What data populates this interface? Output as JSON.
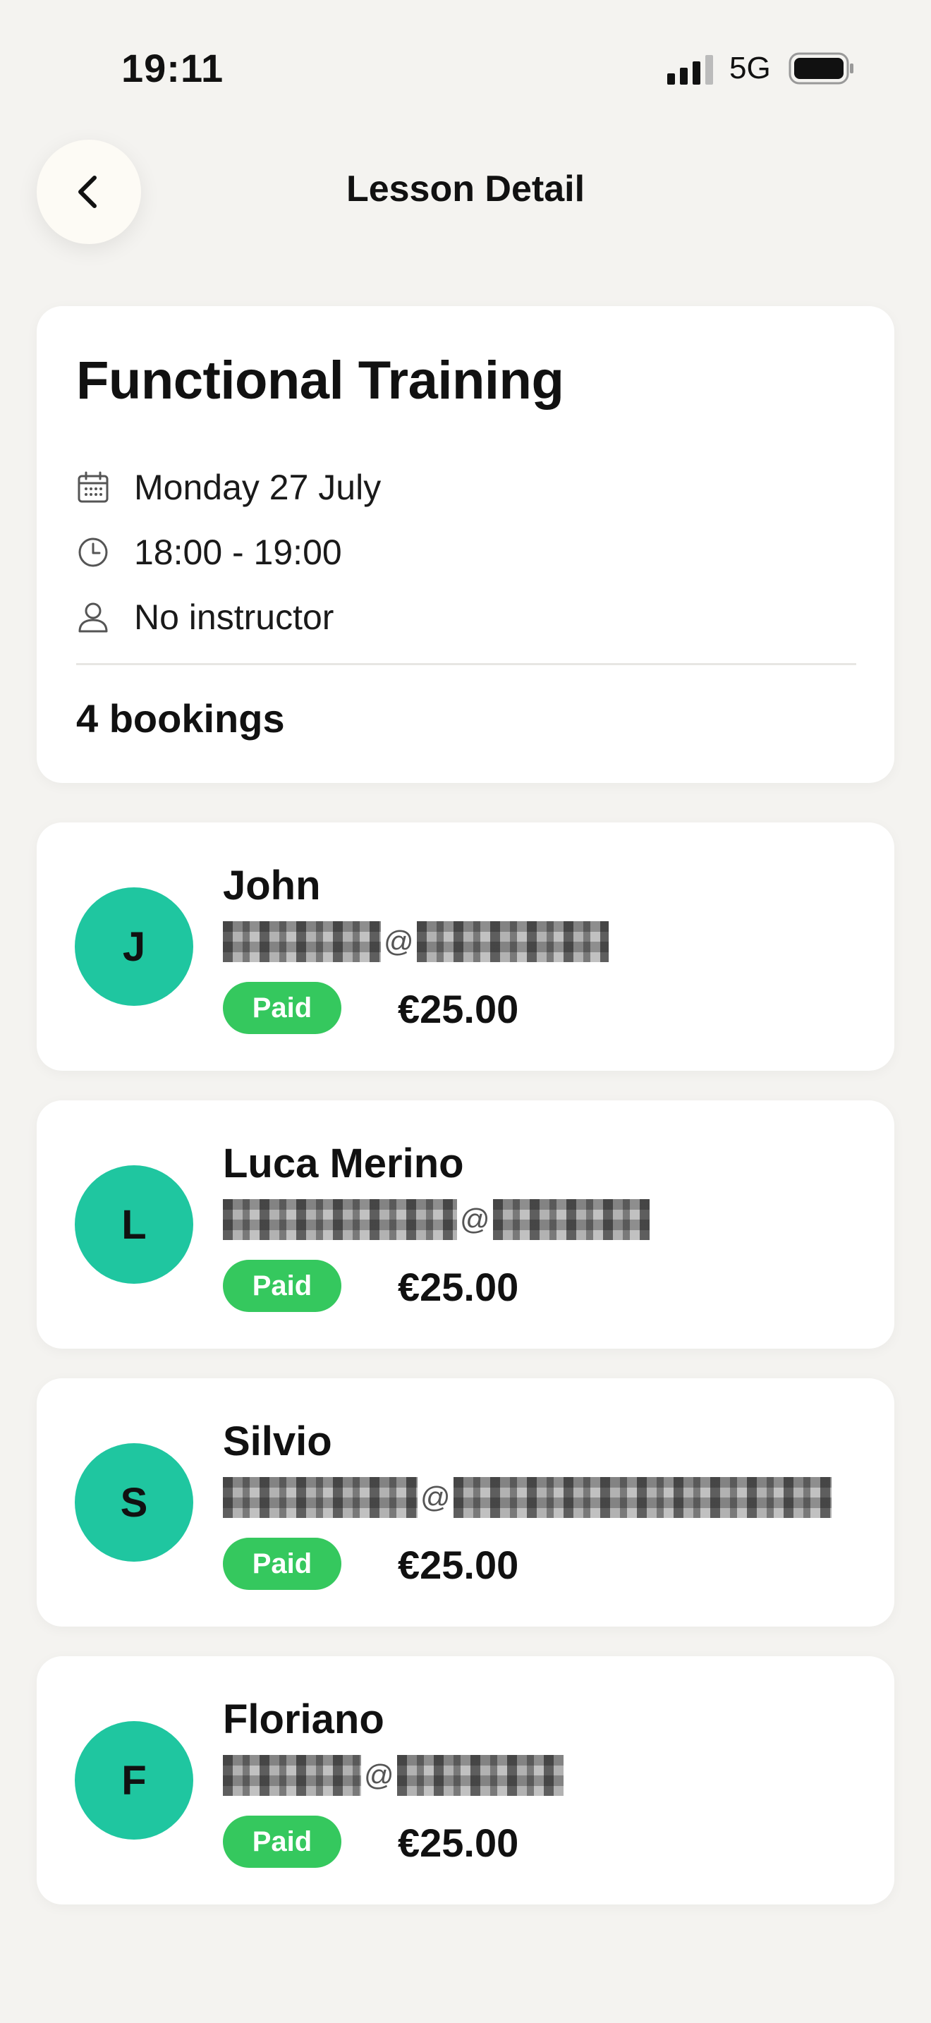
{
  "status_bar": {
    "time": "19:11",
    "network": "5G"
  },
  "header": {
    "title": "Lesson Detail"
  },
  "lesson": {
    "title": "Functional Training",
    "date": "Monday 27 July",
    "time_range": "18:00 - 19:00",
    "instructor": "No instructor",
    "bookings_count": "4 bookings"
  },
  "bookings": [
    {
      "initial": "J",
      "name": "John",
      "status": "Paid",
      "price": "€25.00"
    },
    {
      "initial": "L",
      "name": "Luca Merino",
      "status": "Paid",
      "price": "€25.00"
    },
    {
      "initial": "S",
      "name": "Silvio",
      "status": "Paid",
      "price": "€25.00"
    },
    {
      "initial": "F",
      "name": "Floriano",
      "status": "Paid",
      "price": "€25.00"
    }
  ],
  "email_separator": "@",
  "colors": {
    "avatar": "#1fc6a0",
    "paid_badge": "#35c85e",
    "background": "#f4f3f0"
  }
}
